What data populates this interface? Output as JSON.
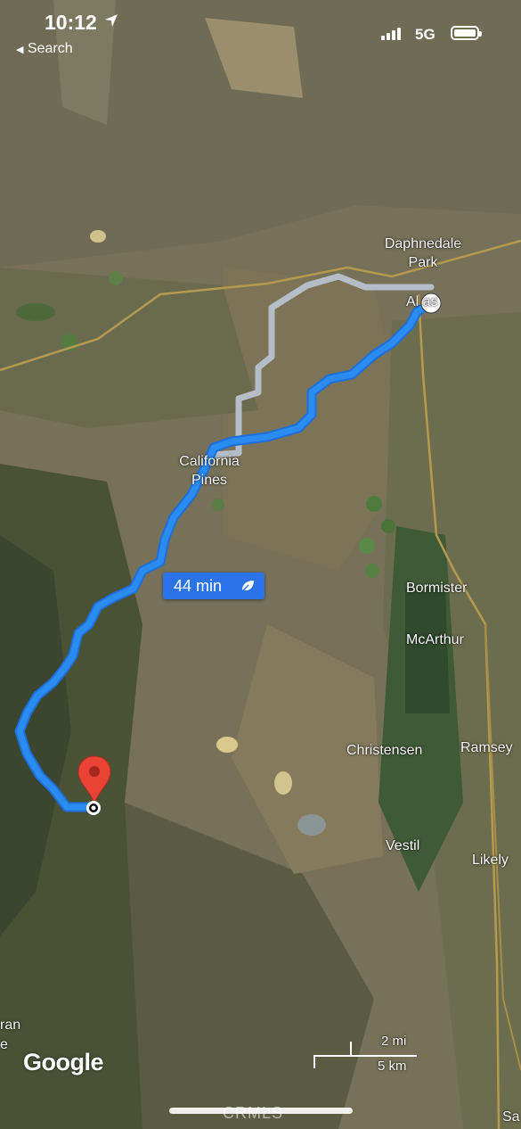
{
  "status_bar": {
    "time": "10:12",
    "back_label": "Search",
    "network": "5G"
  },
  "route": {
    "eta": "44 min",
    "eta_icon": "leaf-icon",
    "route_color": "#2a8cf0",
    "alt_route_color": "#b5bec8"
  },
  "places": {
    "daphnedale_line1": "Daphnedale",
    "daphnedale_line2": "Park",
    "alturas": "Al  as",
    "california_line1": "California",
    "california_line2": "Pines",
    "bormister": "Bormister",
    "mcarthur": "McArthur",
    "christensen": "Christensen",
    "ramsey": "Ramsey",
    "vestil": "Vestil",
    "likely": "Likely",
    "edge_left": "ran",
    "edge_left2": "e",
    "edge_right": "Sa"
  },
  "scale": {
    "miles": "2 mi",
    "km": "5 km"
  },
  "attribution": "Google",
  "watermark": "CRMLS",
  "icons": {
    "destination": "red-pin-icon",
    "origin": "origin-dot-icon"
  }
}
